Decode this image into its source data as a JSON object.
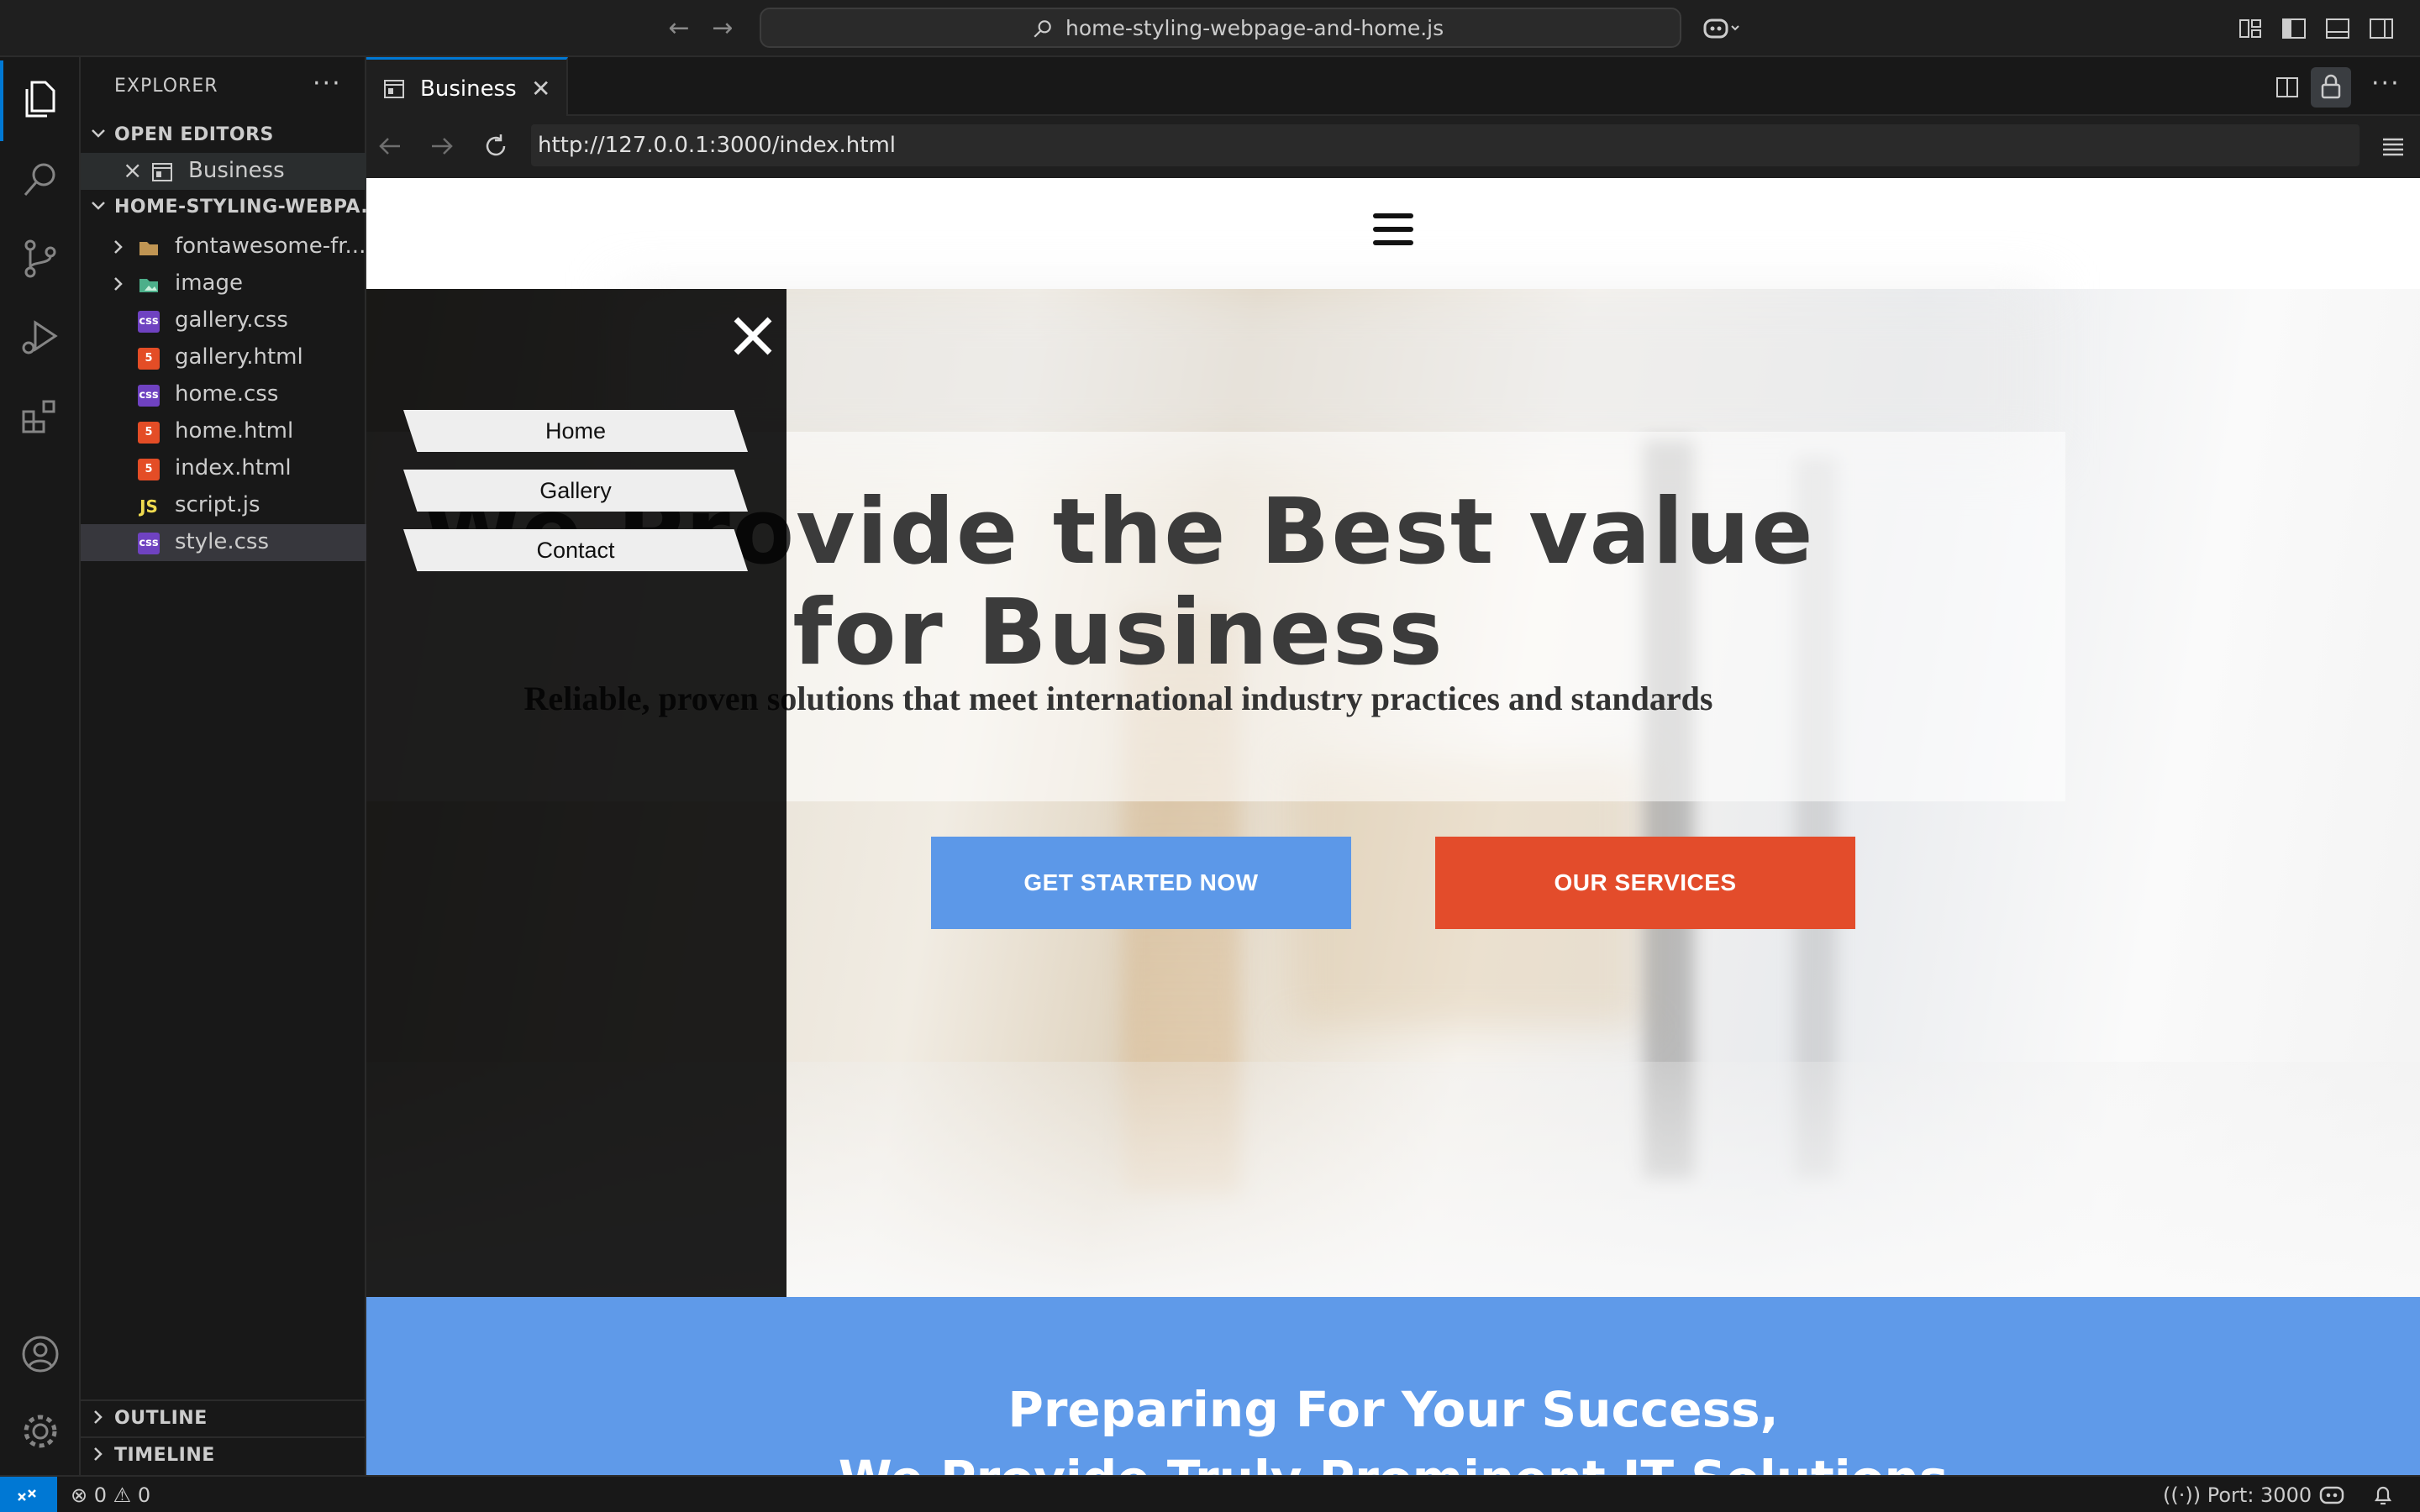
{
  "titlebar": {
    "search_text": "home-styling-webpage-and-home.js"
  },
  "sidebar": {
    "title": "EXPLORER",
    "more": "···",
    "open_editors_label": "OPEN EDITORS",
    "open_editor_item": "Business",
    "project_label": "HOME-STYLING-WEBPA...",
    "files": [
      {
        "name": "fontawesome-fr...",
        "type": "folder"
      },
      {
        "name": "image",
        "type": "folder-image"
      },
      {
        "name": "gallery.css",
        "type": "css"
      },
      {
        "name": "gallery.html",
        "type": "html"
      },
      {
        "name": "home.css",
        "type": "css"
      },
      {
        "name": "home.html",
        "type": "html"
      },
      {
        "name": "index.html",
        "type": "html"
      },
      {
        "name": "script.js",
        "type": "js"
      },
      {
        "name": "style.css",
        "type": "css"
      }
    ],
    "outline_label": "OUTLINE",
    "timeline_label": "TIMELINE"
  },
  "tab": {
    "label": "Business"
  },
  "browser": {
    "url": "http://127.0.0.1:3000/index.html"
  },
  "site": {
    "nav": [
      "Home",
      "Gallery",
      "Contact"
    ],
    "hero_title_line1": "We Provide the Best value",
    "hero_title_line2": "for Business",
    "hero_subtitle": "Reliable, proven solutions that meet international industry practices and standards",
    "btn_start": "GET STARTED NOW",
    "btn_services": "OUR SERVICES",
    "section_title_line1": "Preparing For Your Success,",
    "section_title_line2": "We Provide Truly Prominent IT Solutions"
  },
  "statusbar": {
    "errors": "0",
    "warnings": "0",
    "port": "Port: 3000"
  },
  "colors": {
    "accent": "#0078d4",
    "start_button": "#5c98e8",
    "services_button": "#e34c2b",
    "section_blue": "#5f9ae9"
  }
}
